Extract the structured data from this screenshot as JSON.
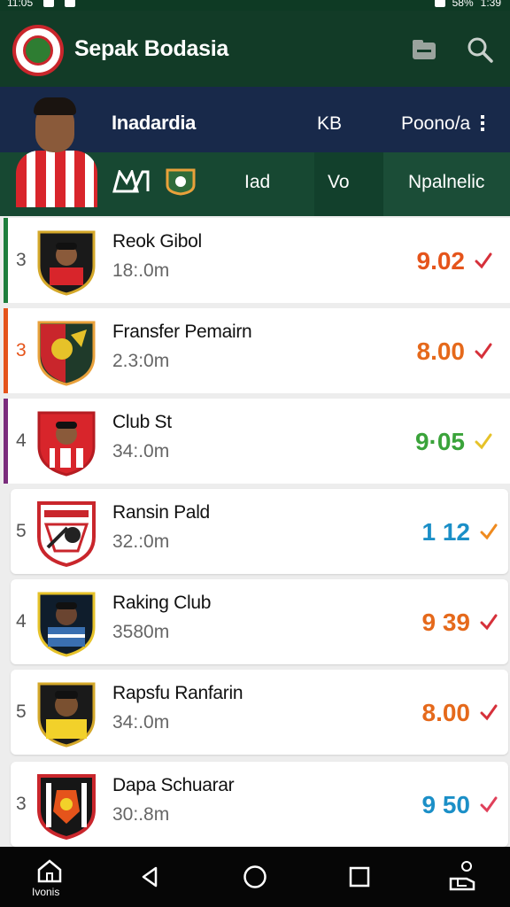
{
  "app": {
    "title": "Sepak Bodasia",
    "icons": [
      "folder-icon",
      "search-icon"
    ]
  },
  "status_bar": {
    "time": "11:05",
    "battery": "58%",
    "clock_right": "1:39"
  },
  "profile": {
    "name": "Inadardia",
    "col_kb": "KB",
    "col_pos": "Poono/a",
    "row_lad": "Iad",
    "row_vo": "Vo",
    "row_npal": "Npalnelic"
  },
  "players": [
    {
      "rank": "3",
      "name": "Reok Gibol",
      "time": "18:.0m",
      "score": "9.02",
      "score_color": "#e5541b",
      "check_color": "#d6303a",
      "stripe": "#1e7d3c"
    },
    {
      "rank": "3",
      "name": "Fransfer Pemairn",
      "time": "2.3:0m",
      "score": "8.00",
      "score_color": "#e5691b",
      "check_color": "#d6303a",
      "stripe": "#e5541b"
    },
    {
      "rank": "4",
      "name": "Club St",
      "time": "34:.0m",
      "score": "9·05",
      "score_color": "#3aa33a",
      "check_color": "#e6c229",
      "stripe": "#7a2c7c"
    },
    {
      "rank": "5",
      "name": "Ransin Pald",
      "time": "32.:0m",
      "score": "1 12",
      "score_color": "#1b8fc7",
      "check_color": "#ef8a1e",
      "stripe": ""
    },
    {
      "rank": "4",
      "name": "Raking Club",
      "time": "3580m",
      "score": "9 39",
      "score_color": "#e5691b",
      "check_color": "#d6303a",
      "stripe": ""
    },
    {
      "rank": "5",
      "name": "Rapsfu Ranfarin",
      "time": "34:.0m",
      "score": "8.00",
      "score_color": "#e5691b",
      "check_color": "#d6303a",
      "stripe": ""
    },
    {
      "rank": "3",
      "name": "Dapa Schuarar",
      "time": "30:.8m",
      "score": "9 50",
      "score_color": "#1b8fc7",
      "check_color": "#e0405a",
      "stripe": ""
    }
  ],
  "nav": {
    "home_label": "Ivonis",
    "items": [
      "home-icon",
      "back-icon",
      "home-circle-icon",
      "recents-square-icon",
      "profile-icon"
    ]
  }
}
